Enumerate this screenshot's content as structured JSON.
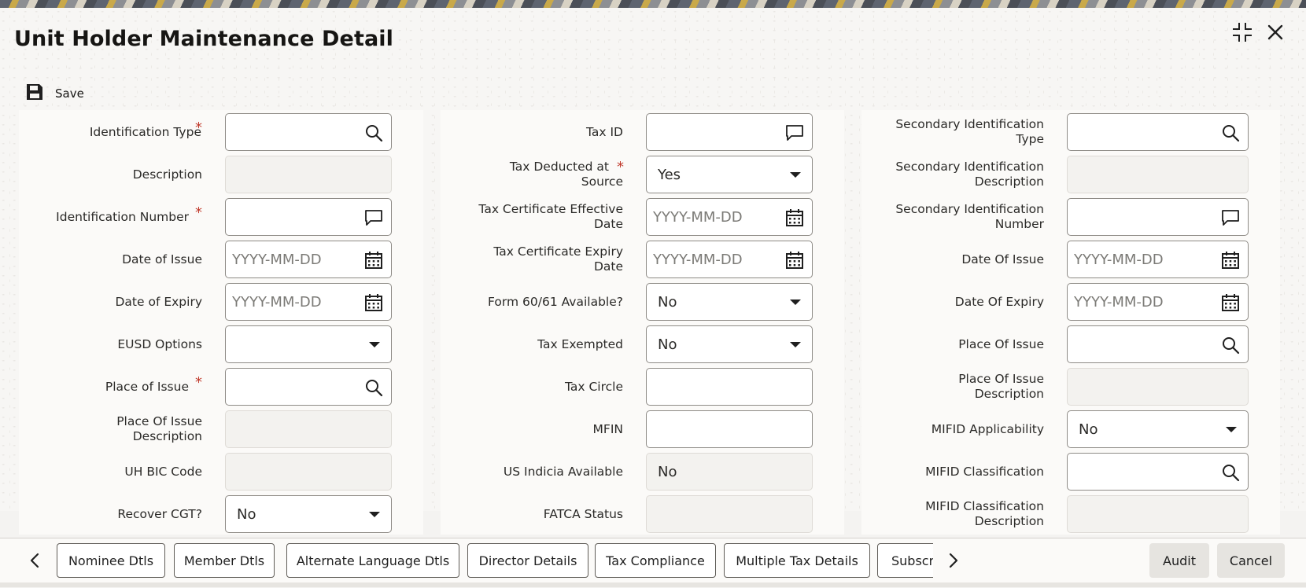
{
  "window": {
    "title": "Unit Holder Maintenance Detail",
    "maximize_icon": "collapse-arrows-icon",
    "close_icon": "close-icon"
  },
  "toolbar": {
    "save_label": "Save",
    "save_icon": "floppy-disk-icon"
  },
  "placeholders": {
    "date": "YYYY-MM-DD"
  },
  "column1": {
    "identification_type": {
      "label": "Identification Type",
      "required": "*",
      "value": ""
    },
    "description": {
      "label": "Description",
      "value": ""
    },
    "identification_number": {
      "label": "Identification Number",
      "required": "*",
      "value": ""
    },
    "date_of_issue": {
      "label": "Date of Issue",
      "value": ""
    },
    "date_of_expiry": {
      "label": "Date of Expiry",
      "value": ""
    },
    "eusd_options": {
      "label": "EUSD Options",
      "value": ""
    },
    "place_of_issue": {
      "label": "Place of Issue",
      "required": "*",
      "value": ""
    },
    "place_of_issue_description": {
      "label_line1": "Place Of Issue",
      "label_line2": "Description",
      "value": ""
    },
    "uh_bic_code": {
      "label": "UH BIC Code",
      "value": ""
    },
    "recover_cgt": {
      "label": "Recover CGT?",
      "value": "No"
    }
  },
  "column2": {
    "tax_id": {
      "label": "Tax ID",
      "value": ""
    },
    "tax_deducted_at_source": {
      "label_line1": "Tax Deducted at",
      "label_line2": "Source",
      "required": "*",
      "value": "Yes"
    },
    "tax_certificate_effective_date": {
      "label_line1": "Tax Certificate Effective",
      "label_line2": "Date",
      "value": ""
    },
    "tax_certificate_expiry_date": {
      "label_line1": "Tax Certificate Expiry",
      "label_line2": "Date",
      "value": ""
    },
    "form_60_61_available": {
      "label": "Form 60/61 Available?",
      "value": "No"
    },
    "tax_exempted": {
      "label": "Tax Exempted",
      "value": "No"
    },
    "tax_circle": {
      "label": "Tax Circle",
      "value": ""
    },
    "mfin": {
      "label": "MFIN",
      "value": ""
    },
    "us_indicia_available": {
      "label": "US Indicia Available",
      "value": "No"
    },
    "fatca_status": {
      "label": "FATCA Status",
      "value": ""
    }
  },
  "column3": {
    "secondary_identification_type": {
      "label_line1": "Secondary Identification",
      "label_line2": "Type",
      "value": ""
    },
    "secondary_identification_description": {
      "label_line1": "Secondary Identification",
      "label_line2": "Description",
      "value": ""
    },
    "secondary_identification_number": {
      "label_line1": "Secondary Identification",
      "label_line2": "Number",
      "value": ""
    },
    "date_of_issue": {
      "label": "Date Of Issue",
      "value": ""
    },
    "date_of_expiry": {
      "label": "Date Of Expiry",
      "value": ""
    },
    "place_of_issue": {
      "label": "Place Of Issue",
      "value": ""
    },
    "place_of_issue_description": {
      "label_line1": "Place Of Issue",
      "label_line2": "Description",
      "value": ""
    },
    "mifid_applicability": {
      "label": "MIFID Applicability",
      "value": "No"
    },
    "mifid_classification": {
      "label": "MIFID Classification",
      "value": ""
    },
    "mifid_classification_description": {
      "label_line1": "MIFID Classification",
      "label_line2": "Description",
      "value": ""
    }
  },
  "footer": {
    "tabs": [
      "Nominee Dtls",
      "Member Dtls",
      "Alternate Language Dtls",
      "Director Details",
      "Tax Compliance",
      "Multiple Tax Details",
      "Subscr"
    ],
    "audit_label": "Audit",
    "cancel_label": "Cancel"
  },
  "colors": {
    "required": "#c0392b",
    "text": "#1f1f1f",
    "border": "#8e8b86"
  }
}
